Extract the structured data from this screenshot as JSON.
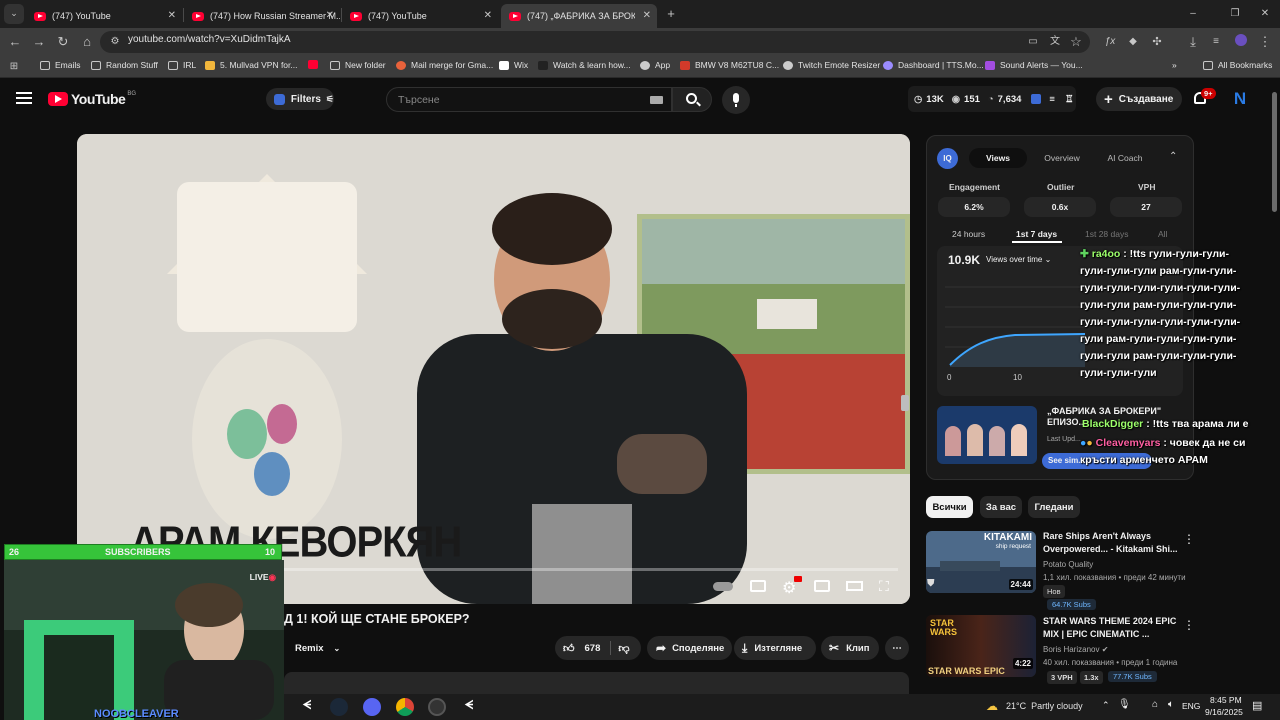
{
  "tabs": [
    {
      "label": "(747) YouTube"
    },
    {
      "label": "(747) How Russian Streamer M..."
    },
    {
      "label": "(747) YouTube"
    },
    {
      "label": "(747) „ФАБРИКА ЗА БРОКЕРИ\""
    }
  ],
  "address": {
    "url": "youtube.com/watch?v=XuDidmTajkA"
  },
  "bookmarks": [
    {
      "label": "Emails"
    },
    {
      "label": "Random Stuff"
    },
    {
      "label": "IRL"
    },
    {
      "label": "5. Mullvad VPN for..."
    },
    {
      "label": "New folder"
    },
    {
      "label": "Mail merge for Gma..."
    },
    {
      "label": "Wix"
    },
    {
      "label": "Watch & learn how..."
    },
    {
      "label": "App"
    },
    {
      "label": "BMW V8 M62TU8 C..."
    },
    {
      "label": "Twitch Emote Resizer"
    },
    {
      "label": "Dashboard | TTS.Mo..."
    },
    {
      "label": "Sound Alerts — You..."
    },
    {
      "label": "All Bookmarks"
    }
  ],
  "yt": {
    "logo": "YouTube",
    "region": "BG",
    "filters": "Filters",
    "search_placeholder": "Търсене",
    "stats": {
      "a": "13K",
      "b": "151",
      "c": "7,634"
    },
    "create": "Създаване",
    "notif": "9+",
    "avatar": "N"
  },
  "video": {
    "overlay_name": "АРАМ КЕВОРКЯН",
    "title": "Д 1! КОЙ ЩЕ СТАНЕ БРОКЕР?",
    "remix": "Remix",
    "likes": "678",
    "share": "Споделяне",
    "download": "Изтегляне",
    "clip": "Клип"
  },
  "panel": {
    "logo": "IQ",
    "tabs": [
      "Views",
      "Overview",
      "AI Coach"
    ],
    "metrics": [
      {
        "label": "Engagement",
        "value": "6.2%"
      },
      {
        "label": "Outlier",
        "value": "0.6x"
      },
      {
        "label": "VPH",
        "value": "27"
      }
    ],
    "ranges": [
      "24 hours",
      "1st 7 days",
      "1st 28 days",
      "All"
    ],
    "total": "10.9K",
    "views_selector": "Views over time",
    "axis": [
      "0",
      "10"
    ],
    "promo_title": "„ФАБРИКА ЗА БРОКЕРИ\" ЕПИЗО...",
    "promo_sub": "Last Upd...",
    "promo_btn": "See sim..."
  },
  "chat": [
    {
      "user": "ra4oo",
      "text": "!tts гули-гули-гули-гули-гули-гули рам-гули-гули-гули-гули-гули-гули-гули-гули-гули-гули рам-гули-гули-гули-гули-гули-гули-гули-гули-гули-гули рам-гули-гули-гули-гули-гули-гули рам-гули-гули-гули-гули-гули-гули"
    },
    {
      "user": "BlackDigger",
      "text": "!tts тва арама ли е"
    },
    {
      "user": "Cleavemyars",
      "text": "човек да не си кръсти арменчето АРАМ"
    }
  ],
  "chips": [
    "Всички",
    "За вас",
    "Гледани"
  ],
  "recs": [
    {
      "title": "Rare Ships Aren't Always Overpowered... - Kitakami Shi...",
      "channel": "Potato Quality",
      "meta": "1,1 хил. показвания • преди 42 минути",
      "badge": "Нов",
      "subs": "64.7K Subs",
      "duration": "24:44",
      "thumb_text": "KITAKAMI",
      "thumb_sub": "ship request"
    },
    {
      "title": "STAR WARS THEME 2024 EPIC MIX | EPIC CINEMATIC ...",
      "channel": "Boris Harizanov",
      "meta": "40 хил. показвания • преди 1 година",
      "badge": "3 VPH",
      "badge2": "1.3x",
      "subs": "77.7K Subs",
      "duration": "4:22",
      "thumb_text": "STAR WARS EPIC"
    }
  ],
  "webcam": {
    "subs_left": "26",
    "subs_label": "SUBSCRIBERS",
    "subs_right": "10",
    "live": "LIVE",
    "name": "NOOBCLEAVER"
  },
  "taskbar": {
    "weather": "21°C  Partly cloudy",
    "lang": "ENG",
    "time": "8:45 PM",
    "date": "9/16/2025"
  },
  "colors": {
    "yt_red": "#ff0033",
    "accent_blue": "#3ea6ff",
    "chat_green": "#9dff6b",
    "chat_pink": "#ff5fa2",
    "bar_green": "#36c43a"
  }
}
